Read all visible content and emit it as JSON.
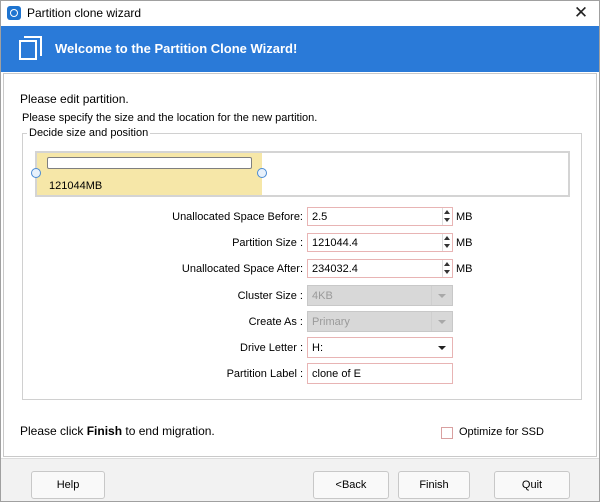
{
  "window": {
    "title": "Partition clone wizard",
    "close_label": "✕"
  },
  "banner": {
    "title": "Welcome to the Partition Clone Wizard!"
  },
  "content": {
    "heading": "Please edit partition.",
    "subheading": "Please specify the size and the location for the new partition.",
    "group_title": "Decide size and position",
    "partition_bar": {
      "size_label": "121044MB"
    },
    "fields": {
      "unallocated_before": {
        "label": "Unallocated Space Before:",
        "value": "2.5",
        "unit": "MB"
      },
      "partition_size": {
        "label": "Partition Size :",
        "value": "121044.4",
        "unit": "MB"
      },
      "unallocated_after": {
        "label": "Unallocated Space After:",
        "value": "234032.4",
        "unit": "MB"
      },
      "cluster_size": {
        "label": "Cluster Size :",
        "value": "4KB"
      },
      "create_as": {
        "label": "Create As :",
        "value": "Primary"
      },
      "drive_letter": {
        "label": "Drive Letter :",
        "value": "H:"
      },
      "partition_label": {
        "label": "Partition Label :",
        "value": "clone of E"
      }
    },
    "finish_note": {
      "prefix": "Please click ",
      "bold": "Finish",
      "suffix": " to end migration."
    },
    "optimize_ssd": {
      "label": "Optimize for SSD",
      "checked": false
    }
  },
  "buttons": {
    "help": "Help",
    "back": "<Back",
    "finish": "Finish",
    "quit": "Quit"
  },
  "colors": {
    "banner": "#2a7ad8",
    "partition_fill": "#f6e7a8",
    "field_border": "#e8b4b4"
  }
}
